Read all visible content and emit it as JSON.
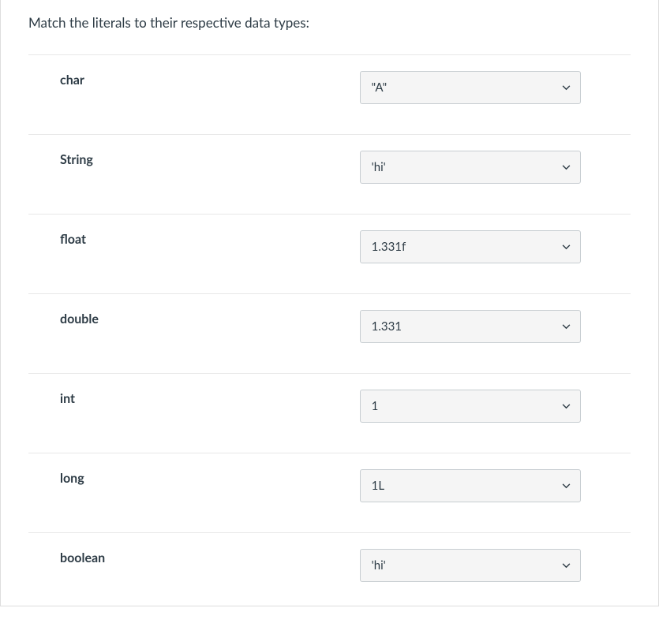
{
  "prompt": "Match the literals to their respective data types:",
  "rows": [
    {
      "label": "char",
      "value": "\"A\""
    },
    {
      "label": "String",
      "value": "'hi'"
    },
    {
      "label": "float",
      "value": "1.331f"
    },
    {
      "label": "double",
      "value": "1.331"
    },
    {
      "label": "int",
      "value": "1"
    },
    {
      "label": "long",
      "value": "1L"
    },
    {
      "label": "boolean",
      "value": "'hi'"
    }
  ]
}
